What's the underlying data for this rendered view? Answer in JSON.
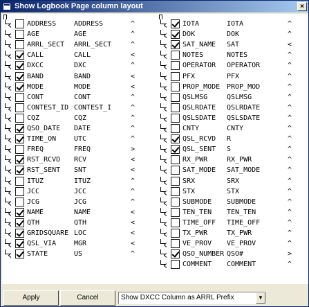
{
  "window": {
    "title": "Show Logbook Page column layout",
    "close_label": "×"
  },
  "left_rows": [
    {
      "name": "ADDRESS",
      "short": "ADDRESS",
      "align": "^",
      "checked": false
    },
    {
      "name": "AGE",
      "short": "AGE",
      "align": "^",
      "checked": false
    },
    {
      "name": "ARRL_SECT",
      "short": "ARRL_SECT",
      "align": "^",
      "checked": false
    },
    {
      "name": "CALL",
      "short": "CALL",
      "align": "<",
      "checked": true
    },
    {
      "name": "DXCC",
      "short": "DXC",
      "align": "^",
      "checked": true
    },
    {
      "name": "BAND",
      "short": "BAND",
      "align": "<",
      "checked": true
    },
    {
      "name": "MODE",
      "short": "MODE",
      "align": "<",
      "checked": true
    },
    {
      "name": "CONT",
      "short": "CONT",
      "align": "^",
      "checked": false
    },
    {
      "name": "CONTEST_ID",
      "short": "CONTEST_I",
      "align": "^",
      "checked": false
    },
    {
      "name": "CQZ",
      "short": "CQZ",
      "align": "^",
      "checked": false
    },
    {
      "name": "QSO_DATE",
      "short": "DATE",
      "align": "^",
      "checked": true
    },
    {
      "name": "TIME_ON",
      "short": "UTC",
      "align": "^",
      "checked": true
    },
    {
      "name": "FREQ",
      "short": "FREQ",
      "align": ">",
      "checked": false
    },
    {
      "name": "RST_RCVD",
      "short": "RCV",
      "align": "<",
      "checked": true
    },
    {
      "name": "RST_SENT",
      "short": "SNT",
      "align": "<",
      "checked": true
    },
    {
      "name": "ITUZ",
      "short": "ITUZ",
      "align": "^",
      "checked": false
    },
    {
      "name": "JCC",
      "short": "JCC",
      "align": "^",
      "checked": false
    },
    {
      "name": "JCG",
      "short": "JCG",
      "align": "^",
      "checked": false
    },
    {
      "name": "NAME",
      "short": "NAME",
      "align": "<",
      "checked": true
    },
    {
      "name": "QTH",
      "short": "QTH",
      "align": "<",
      "checked": true
    },
    {
      "name": "GRIDSQUARE",
      "short": "LOC",
      "align": "<",
      "checked": true
    },
    {
      "name": "QSL_VIA",
      "short": "MGR",
      "align": "<",
      "checked": true
    },
    {
      "name": "STATE",
      "short": "US",
      "align": "^",
      "checked": true
    }
  ],
  "right_rows": [
    {
      "name": "IOTA",
      "short": "IOTA",
      "align": "^",
      "checked": true
    },
    {
      "name": "DOK",
      "short": "DOK",
      "align": "^",
      "checked": true
    },
    {
      "name": "SAT_NAME",
      "short": "SAT",
      "align": "<",
      "checked": true
    },
    {
      "name": "NOTES",
      "short": "NOTES",
      "align": "^",
      "checked": false
    },
    {
      "name": "OPERATOR",
      "short": "OPERATOR",
      "align": "^",
      "checked": false
    },
    {
      "name": "PFX",
      "short": "PFX",
      "align": "^",
      "checked": false
    },
    {
      "name": "PROP_MODE",
      "short": "PROP_MOD",
      "align": "^",
      "checked": false
    },
    {
      "name": "QSLMSG",
      "short": "QSLMSG",
      "align": "^",
      "checked": false
    },
    {
      "name": "QSLRDATE",
      "short": "QSLRDATE",
      "align": "^",
      "checked": false
    },
    {
      "name": "QSLSDATE",
      "short": "QSLSDATE",
      "align": "^",
      "checked": false
    },
    {
      "name": "CNTY",
      "short": "CNTY",
      "align": "^",
      "checked": false
    },
    {
      "name": "QSL_RCVD",
      "short": "R",
      "align": "^",
      "checked": true
    },
    {
      "name": "QSL_SENT",
      "short": "S",
      "align": "^",
      "checked": true
    },
    {
      "name": "RX_PWR",
      "short": "RX_PWR",
      "align": "^",
      "checked": false
    },
    {
      "name": "SAT_MODE",
      "short": "SAT_MODE",
      "align": "^",
      "checked": false
    },
    {
      "name": "SRX",
      "short": "SRX",
      "align": "^",
      "checked": false
    },
    {
      "name": "STX",
      "short": "STX",
      "align": "^",
      "checked": false
    },
    {
      "name": "SUBMODE",
      "short": "SUBMODE",
      "align": "^",
      "checked": false
    },
    {
      "name": "TEN_TEN",
      "short": "TEN_TEN",
      "align": "^",
      "checked": false
    },
    {
      "name": "TIME_OFF",
      "short": "TIME_OFF",
      "align": "^",
      "checked": false
    },
    {
      "name": "TX_PWR",
      "short": "TX_PWR",
      "align": "^",
      "checked": false
    },
    {
      "name": "VE_PROV",
      "short": "VE_PROV",
      "align": "^",
      "checked": false
    },
    {
      "name": "QSO_NUMBER",
      "short": "QSO#",
      "align": ">",
      "checked": true
    },
    {
      "name": "COMMENT",
      "short": "COMMENT",
      "align": "^",
      "checked": false
    }
  ],
  "buttons": {
    "apply": "Apply",
    "cancel": "Cancel"
  },
  "dxcc_select": {
    "value": "Show DXCC Column as ARRL Prefix"
  }
}
